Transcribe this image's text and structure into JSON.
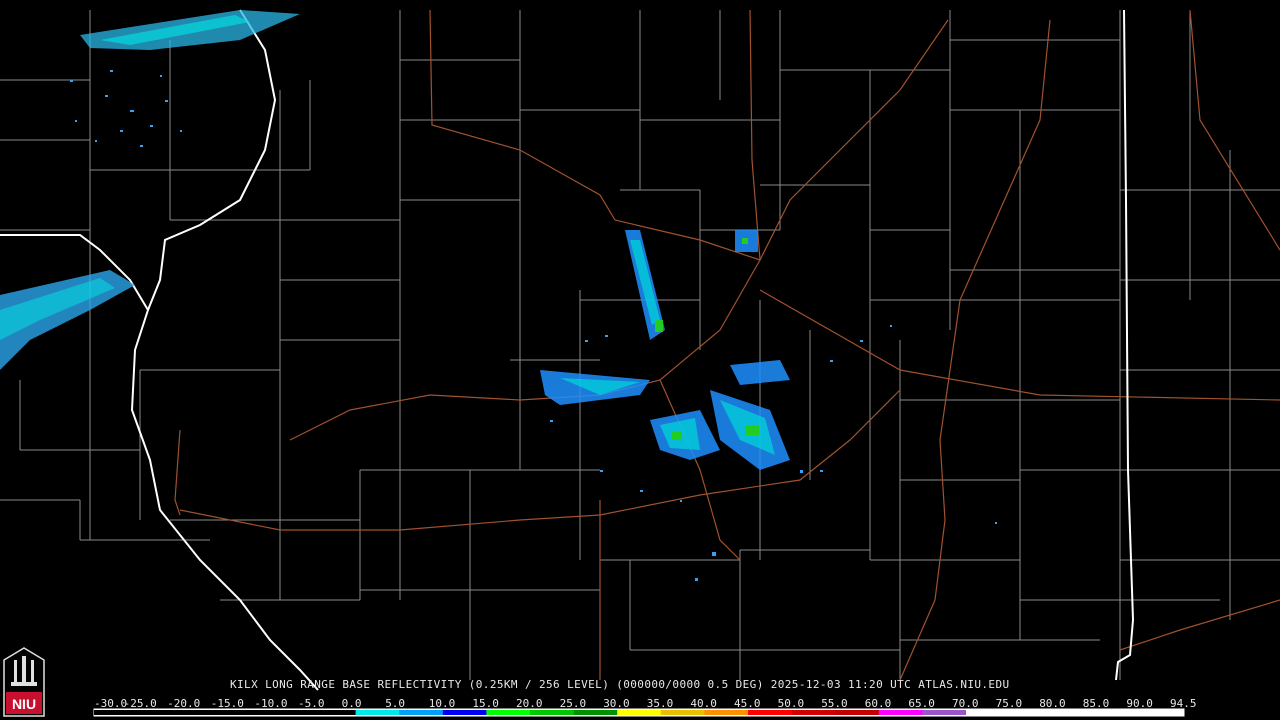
{
  "caption": "KILX LONG RANGE BASE REFLECTIVITY (0.25KM / 256 LEVEL) (000000/0000 0.5 DEG) 2025-12-03 11:20 UTC  ATLAS.NIU.EDU",
  "logo": {
    "text": "NIU",
    "icon": "niu-logo-icon",
    "color": "#c8102e"
  },
  "colors": {
    "background": "#000000",
    "counties": "#8a8a8a",
    "states": "#ffffff",
    "highways": "#a0522d"
  },
  "colorbar": {
    "labels": [
      "-30.0",
      "-25.0",
      "-20.0",
      "-15.0",
      "-10.0",
      "-5.0",
      "0.0",
      "5.0",
      "10.0",
      "15.0",
      "20.0",
      "25.0",
      "30.0",
      "35.0",
      "40.0",
      "45.0",
      "50.0",
      "55.0",
      "60.0",
      "65.0",
      "70.0",
      "75.0",
      "80.0",
      "85.0",
      "90.0",
      "94.5"
    ],
    "colors": [
      "#000000",
      "#000000",
      "#000000",
      "#000000",
      "#000000",
      "#000000",
      "#00e8e8",
      "#00a0f8",
      "#0000f0",
      "#00ff00",
      "#00c800",
      "#009000",
      "#ffff00",
      "#e8c000",
      "#ff9000",
      "#ff0000",
      "#d00000",
      "#c00000",
      "#ff00ff",
      "#9955c9",
      "#ffffff",
      "#ffffff",
      "#ffffff",
      "#ffffff",
      "#ffffff"
    ]
  }
}
